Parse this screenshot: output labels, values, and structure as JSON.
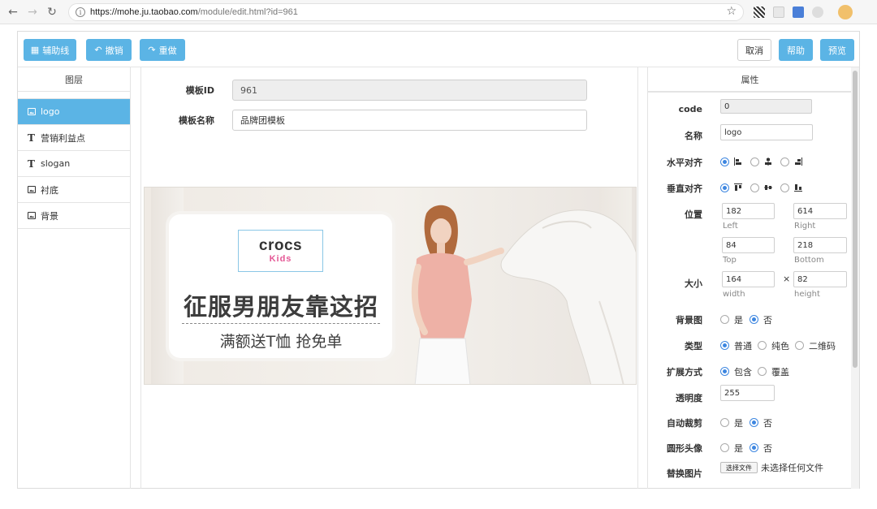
{
  "browser": {
    "url_host": "https://mohe.ju.taobao.com",
    "url_path": "/module/edit.html?id=961"
  },
  "toolbar": {
    "guides_label": "辅助线",
    "undo_label": "撤销",
    "redo_label": "重做",
    "cancel_label": "取消",
    "help_label": "帮助",
    "preview_label": "预览",
    "accent": "#5bb4e5"
  },
  "layers": {
    "title": "图层",
    "items": [
      {
        "label": "logo",
        "icon": "image-icon",
        "active": true
      },
      {
        "label": "营销利益点",
        "icon": "text-icon",
        "active": false
      },
      {
        "label": "slogan",
        "icon": "text-icon",
        "active": false
      },
      {
        "label": "衬底",
        "icon": "image-icon",
        "active": false
      },
      {
        "label": "背景",
        "icon": "image-icon",
        "active": false
      }
    ]
  },
  "form": {
    "template_id_label": "模板ID",
    "template_id_value": "961",
    "template_name_label": "模板名称",
    "template_name_value": "品牌团模板"
  },
  "banner": {
    "logo_main": "crocs",
    "logo_sub": "Kids",
    "headline": "征服男朋友靠这招",
    "subline": "满额送T恤 抢免单"
  },
  "props": {
    "title": "属性",
    "code_label": "code",
    "code_value": "0",
    "name_label": "名称",
    "name_value": "logo",
    "halign_label": "水平对齐",
    "valign_label": "垂直对齐",
    "position_label": "位置",
    "left_value": "182",
    "left_caption": "Left",
    "right_value": "614",
    "right_caption": "Right",
    "top_value": "84",
    "top_caption": "Top",
    "bottom_value": "218",
    "bottom_caption": "Bottom",
    "size_label": "大小",
    "width_value": "164",
    "width_caption": "width",
    "times": "×",
    "height_value": "82",
    "height_caption": "height",
    "bgimg_label": "背景图",
    "yes": "是",
    "no": "否",
    "type_label": "类型",
    "type_normal": "普通",
    "type_solid": "纯色",
    "type_qr": "二维码",
    "expand_label": "扩展方式",
    "expand_contain": "包含",
    "expand_cover": "覆盖",
    "opacity_label": "透明度",
    "opacity_value": "255",
    "autocrop_label": "自动裁剪",
    "round_label": "圆形头像",
    "replace_label": "替换图片",
    "file_button": "选择文件",
    "file_status": "未选择任何文件"
  }
}
